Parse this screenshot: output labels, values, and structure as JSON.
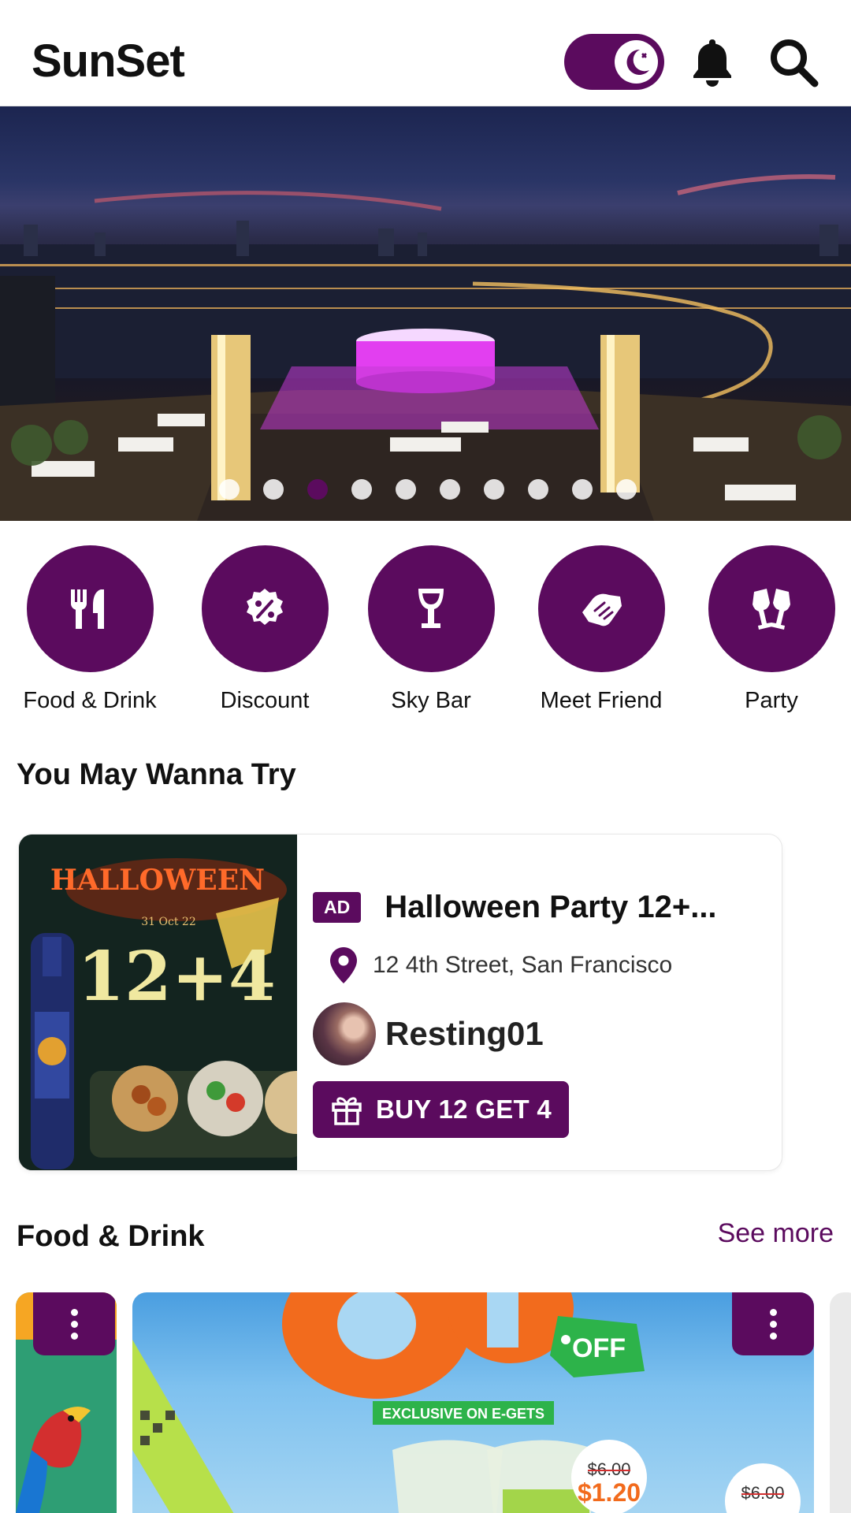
{
  "app": {
    "title": "SunSet"
  },
  "header": {
    "theme_toggle": {
      "state": "dark",
      "icon": "moon-star-icon"
    },
    "icons": [
      "bell-icon",
      "search-icon"
    ]
  },
  "carousel": {
    "slide_count": 10,
    "active_index": 2
  },
  "categories": [
    {
      "label": "Food & Drink",
      "icon": "fork-knife-icon"
    },
    {
      "label": "Discount",
      "icon": "percent-badge-icon"
    },
    {
      "label": "Sky Bar",
      "icon": "wine-glass-icon"
    },
    {
      "label": "Meet Friend",
      "icon": "handshake-icon"
    },
    {
      "label": "Party",
      "icon": "cheers-icon"
    }
  ],
  "try_section": {
    "title": "You May Wanna Try",
    "card": {
      "badge": "AD",
      "title": "Halloween Party 12+...",
      "location": "12 4th Street, San Francisco",
      "username": "Resting01",
      "promo": "BUY 12 GET 4",
      "image_text": {
        "headline": "HALLOWEEN",
        "date": "31 Oct 22",
        "offer": "12+4"
      }
    }
  },
  "food_section": {
    "title": "Food & Drink",
    "see_more": "See more",
    "promo_image_text": {
      "off": "OFF",
      "exclusive": "EXCLUSIVE ON E-GETS",
      "old_price": "$6.00",
      "new_price": "$1.20"
    }
  },
  "colors": {
    "accent": "#5b0b5e",
    "background": "#ffffff"
  }
}
